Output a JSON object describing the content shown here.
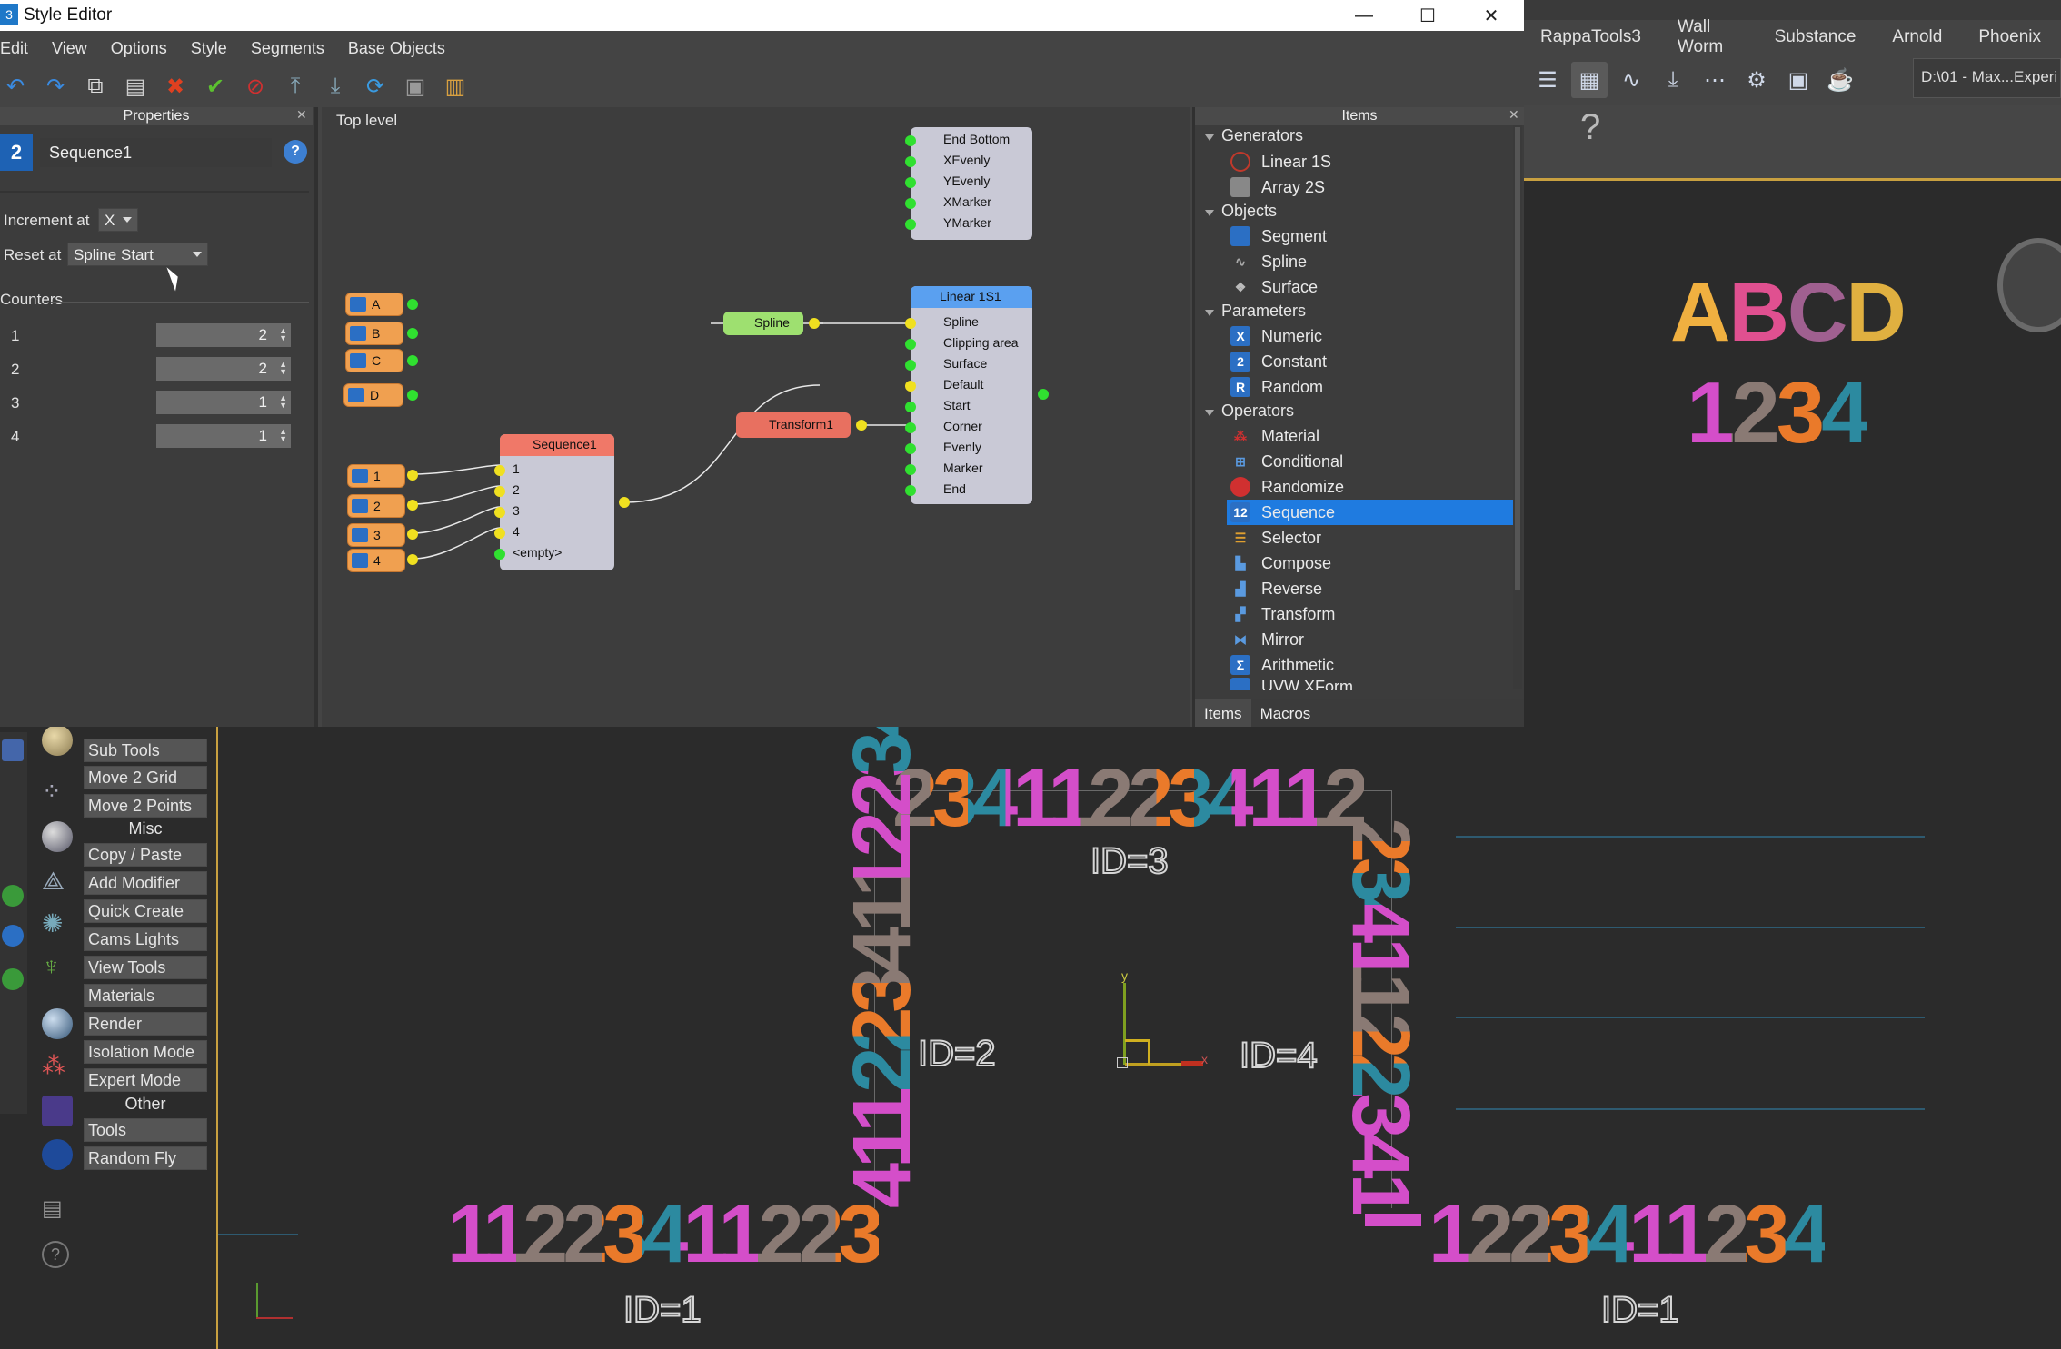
{
  "window": {
    "title": "Style Editor"
  },
  "menu": [
    "Edit",
    "View",
    "Options",
    "Style",
    "Segments",
    "Base Objects"
  ],
  "max_menu": [
    "RappaTools3",
    "Wall Worm",
    "Substance",
    "Arnold",
    "Phoenix"
  ],
  "max_path": "D:\\01 - Max...Experi",
  "properties": {
    "header": "Properties",
    "name": "Sequence1",
    "help": "?",
    "increment_label": "Increment at",
    "increment_value": "X",
    "reset_label": "Reset at",
    "reset_value": "Spline Start",
    "counters_label": "Counters",
    "counters": [
      {
        "index": "1",
        "value": "2"
      },
      {
        "index": "2",
        "value": "2"
      },
      {
        "index": "3",
        "value": "1"
      },
      {
        "index": "4",
        "value": "1"
      }
    ]
  },
  "graph": {
    "header": "Top level",
    "top_node_ports": [
      "End Bottom",
      "XEvenly",
      "YEvenly",
      "XMarker",
      "YMarker"
    ],
    "linear_node": {
      "title": "Linear 1S1",
      "ports": [
        "Spline",
        "Clipping area",
        "Surface",
        "Default",
        "Start",
        "Corner",
        "Evenly",
        "Marker",
        "End"
      ]
    },
    "spline_node": "Spline",
    "transform_node": "Transform1",
    "sequence_node": {
      "title": "Sequence1",
      "ports": [
        "1",
        "2",
        "3",
        "4",
        "<empty>"
      ]
    },
    "letter_nodes": [
      "A",
      "B",
      "C",
      "D"
    ],
    "number_nodes": [
      "1",
      "2",
      "3",
      "4"
    ]
  },
  "items": {
    "header": "Items",
    "categories": [
      {
        "name": "Generators",
        "items": [
          {
            "label": "Linear 1S",
            "icon": "linear-icon",
            "color": "#c0392b"
          },
          {
            "label": "Array 2S",
            "icon": "array-icon",
            "color": "#7a7a7a"
          }
        ]
      },
      {
        "name": "Objects",
        "items": [
          {
            "label": "Segment",
            "icon": "segment-icon",
            "color": "#2b6fc4"
          },
          {
            "label": "Spline",
            "icon": "spline-icon",
            "color": "#888"
          },
          {
            "label": "Surface",
            "icon": "surface-icon",
            "color": "#888"
          }
        ]
      },
      {
        "name": "Parameters",
        "items": [
          {
            "label": "Numeric",
            "icon": "numeric-icon",
            "color": "#2b6fc4"
          },
          {
            "label": "Constant",
            "icon": "constant-icon",
            "color": "#2b6fc4"
          },
          {
            "label": "Random",
            "icon": "random-icon",
            "color": "#2b6fc4"
          }
        ]
      },
      {
        "name": "Operators",
        "items": [
          {
            "label": "Material",
            "icon": "material-icon",
            "color": "#d03030"
          },
          {
            "label": "Conditional",
            "icon": "conditional-icon",
            "color": "#2b6fc4"
          },
          {
            "label": "Randomize",
            "icon": "randomize-icon",
            "color": "#d03030"
          },
          {
            "label": "Sequence",
            "icon": "sequence-icon",
            "color": "#2b6fc4",
            "selected": true
          },
          {
            "label": "Selector",
            "icon": "selector-icon",
            "color": "#e0a030"
          },
          {
            "label": "Compose",
            "icon": "compose-icon",
            "color": "#2b6fc4"
          },
          {
            "label": "Reverse",
            "icon": "reverse-icon",
            "color": "#2b6fc4"
          },
          {
            "label": "Transform",
            "icon": "transform-icon",
            "color": "#2b6fc4"
          },
          {
            "label": "Mirror",
            "icon": "mirror-icon",
            "color": "#2b6fc4"
          },
          {
            "label": "Arithmetic",
            "icon": "arithmetic-icon",
            "color": "#2b6fc4"
          },
          {
            "label": "UVW XForm",
            "icon": "uvw-icon",
            "color": "#2b6fc4"
          }
        ]
      }
    ],
    "tabs": [
      "Items",
      "Macros"
    ]
  },
  "left_panel": {
    "buttons_a": [
      "Sub Tools",
      "Move 2 Grid",
      "Move 2 Points"
    ],
    "section_misc": "Misc",
    "buttons_b": [
      "Copy / Paste",
      "Add Modifier",
      "Quick Create",
      "Cams Lights",
      "View Tools",
      "Materials",
      "Render",
      "Isolation Mode",
      "Expert Mode"
    ],
    "section_other": "Other",
    "buttons_c": [
      "Tools",
      "Random Fly"
    ]
  },
  "viewport": {
    "preview_letters": "ABCD",
    "preview_numbers": "1234",
    "top_text": "234112234112",
    "id_labels": [
      "ID=3",
      "ID=2",
      "ID=4",
      "ID=1",
      "ID=1"
    ],
    "bottom_left_text": "11223411223",
    "bottom_right_text": "1223411234",
    "axis_y": "y",
    "axis_x": "x"
  }
}
